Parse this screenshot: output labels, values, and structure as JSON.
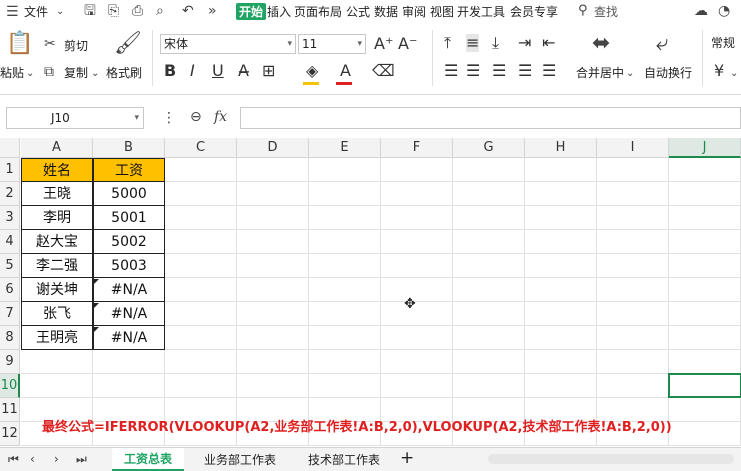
{
  "menu": {
    "file_label": "文件",
    "tabs": [
      "开始",
      "插入",
      "页面布局",
      "公式",
      "数据",
      "审阅",
      "视图",
      "开发工具",
      "会员专享"
    ],
    "active_tab": "开始",
    "search_label": "查找"
  },
  "ribbon": {
    "paste_label": "粘贴",
    "cut_label": "剪切",
    "copy_label": "复制",
    "format_painter_label": "格式刷",
    "font_name": "宋体",
    "font_size": "11",
    "merge_center_label": "合并居中",
    "wrap_text_label": "自动换行",
    "number_format": "常规",
    "currency_symbol": "¥"
  },
  "formula_bar": {
    "name_box": "J10",
    "fx_label": "fx",
    "formula": ""
  },
  "sheet": {
    "columns": [
      "A",
      "B",
      "C",
      "D",
      "E",
      "F",
      "G",
      "H",
      "I",
      "J"
    ],
    "rows": [
      "1",
      "2",
      "3",
      "4",
      "5",
      "6",
      "7",
      "8",
      "9",
      "10",
      "11",
      "12"
    ],
    "selected_column": "J",
    "selected_row": "10",
    "table_header": [
      "姓名",
      "工资"
    ],
    "table_rows": [
      [
        "王晓",
        "5000"
      ],
      [
        "李明",
        "5001"
      ],
      [
        "赵大宝",
        "5002"
      ],
      [
        "李二强",
        "5003"
      ],
      [
        "谢关坤",
        "#N/A"
      ],
      [
        "张飞",
        "#N/A"
      ],
      [
        "王明亮",
        "#N/A"
      ]
    ],
    "header_fill": "#FFC000",
    "note": "最终公式=IFERROR(VLOOKUP(A2,业务部工作表!A:B,2,0),VLOOKUP(A2,技术部工作表!A:B,2,0))",
    "note_color": "#E02020",
    "selection_color": "#1E8A4C"
  },
  "sheet_tabs": {
    "tabs": [
      "工资总表",
      "业务部工作表",
      "技术部工作表"
    ],
    "active": "工资总表",
    "add_label": "+"
  }
}
